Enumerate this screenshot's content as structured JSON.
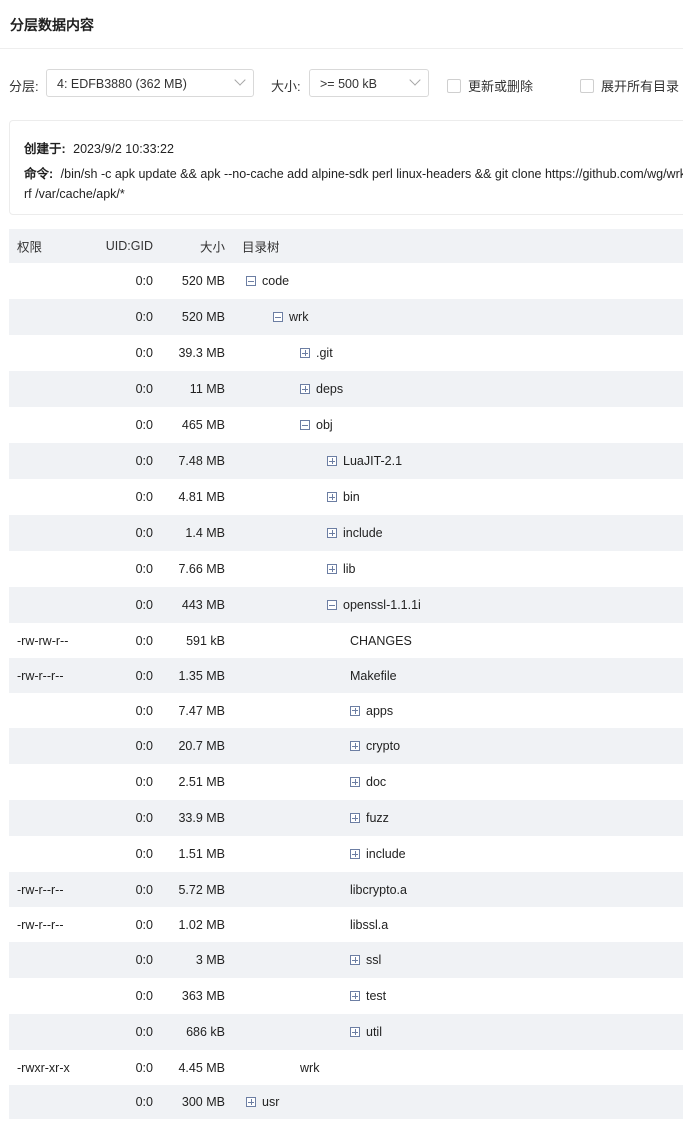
{
  "title": "分层数据内容",
  "filters": {
    "layer_label": "分层:",
    "layer_value": "4: EDFB3880 (362 MB)",
    "size_label": "大小:",
    "size_value": ">= 500 kB",
    "changed_label": "更新或删除",
    "expand_label": "展开所有目录"
  },
  "info": {
    "created_label": "创建于:",
    "created_value": "2023/9/2 10:33:22",
    "command_label": "命令:",
    "command_value": "/bin/sh -c apk update && apk --no-cache add alpine-sdk perl linux-headers && git clone https://github.com/wg/wrk.git && cd wrk && make && cp wrk /usr/local/bin && cd .. && rm -rf wrk && rm -rf /var/cache/apk/*",
    "command_line2": "rf /var/cache/apk/*"
  },
  "table": {
    "headers": {
      "perm": "权限",
      "uid": "UID:GID",
      "size": "大小",
      "tree": "目录树"
    },
    "rows": [
      {
        "perm": "",
        "uid": "0:0",
        "size": "520 MB",
        "name": "code",
        "toggle": "minus",
        "depth": 0
      },
      {
        "perm": "",
        "uid": "0:0",
        "size": "520 MB",
        "name": "wrk",
        "toggle": "minus",
        "depth": 1
      },
      {
        "perm": "",
        "uid": "0:0",
        "size": "39.3 MB",
        "name": ".git",
        "toggle": "plus",
        "depth": 2
      },
      {
        "perm": "",
        "uid": "0:0",
        "size": "11 MB",
        "name": "deps",
        "toggle": "plus",
        "depth": 2
      },
      {
        "perm": "",
        "uid": "0:0",
        "size": "465 MB",
        "name": "obj",
        "toggle": "minus",
        "depth": 2
      },
      {
        "perm": "",
        "uid": "0:0",
        "size": "7.48 MB",
        "name": "LuaJIT-2.1",
        "toggle": "plus",
        "depth": 3
      },
      {
        "perm": "",
        "uid": "0:0",
        "size": "4.81 MB",
        "name": "bin",
        "toggle": "plus",
        "depth": 3
      },
      {
        "perm": "",
        "uid": "0:0",
        "size": "1.4 MB",
        "name": "include",
        "toggle": "plus",
        "depth": 3
      },
      {
        "perm": "",
        "uid": "0:0",
        "size": "7.66 MB",
        "name": "lib",
        "toggle": "plus",
        "depth": 3
      },
      {
        "perm": "",
        "uid": "0:0",
        "size": "443 MB",
        "name": "openssl-1.1.1i",
        "toggle": "minus",
        "depth": 3
      },
      {
        "perm": "-rw-rw-r--",
        "uid": "0:0",
        "size": "591 kB",
        "name": "CHANGES",
        "toggle": "",
        "depth": 4
      },
      {
        "perm": "-rw-r--r--",
        "uid": "0:0",
        "size": "1.35 MB",
        "name": "Makefile",
        "toggle": "",
        "depth": 4
      },
      {
        "perm": "",
        "uid": "0:0",
        "size": "7.47 MB",
        "name": "apps",
        "toggle": "plus",
        "depth": 4
      },
      {
        "perm": "",
        "uid": "0:0",
        "size": "20.7 MB",
        "name": "crypto",
        "toggle": "plus",
        "depth": 4
      },
      {
        "perm": "",
        "uid": "0:0",
        "size": "2.51 MB",
        "name": "doc",
        "toggle": "plus",
        "depth": 4
      },
      {
        "perm": "",
        "uid": "0:0",
        "size": "33.9 MB",
        "name": "fuzz",
        "toggle": "plus",
        "depth": 4
      },
      {
        "perm": "",
        "uid": "0:0",
        "size": "1.51 MB",
        "name": "include",
        "toggle": "plus",
        "depth": 4
      },
      {
        "perm": "-rw-r--r--",
        "uid": "0:0",
        "size": "5.72 MB",
        "name": "libcrypto.a",
        "toggle": "",
        "depth": 4
      },
      {
        "perm": "-rw-r--r--",
        "uid": "0:0",
        "size": "1.02 MB",
        "name": "libssl.a",
        "toggle": "",
        "depth": 4
      },
      {
        "perm": "",
        "uid": "0:0",
        "size": "3 MB",
        "name": "ssl",
        "toggle": "plus",
        "depth": 4
      },
      {
        "perm": "",
        "uid": "0:0",
        "size": "363 MB",
        "name": "test",
        "toggle": "plus",
        "depth": 4
      },
      {
        "perm": "",
        "uid": "0:0",
        "size": "686 kB",
        "name": "util",
        "toggle": "plus",
        "depth": 4
      },
      {
        "perm": "-rwxr-xr-x",
        "uid": "0:0",
        "size": "4.45 MB",
        "name": "wrk",
        "toggle": "",
        "depth": 2
      },
      {
        "perm": "",
        "uid": "0:0",
        "size": "300 MB",
        "name": "usr",
        "toggle": "plus",
        "depth": 0
      }
    ]
  }
}
